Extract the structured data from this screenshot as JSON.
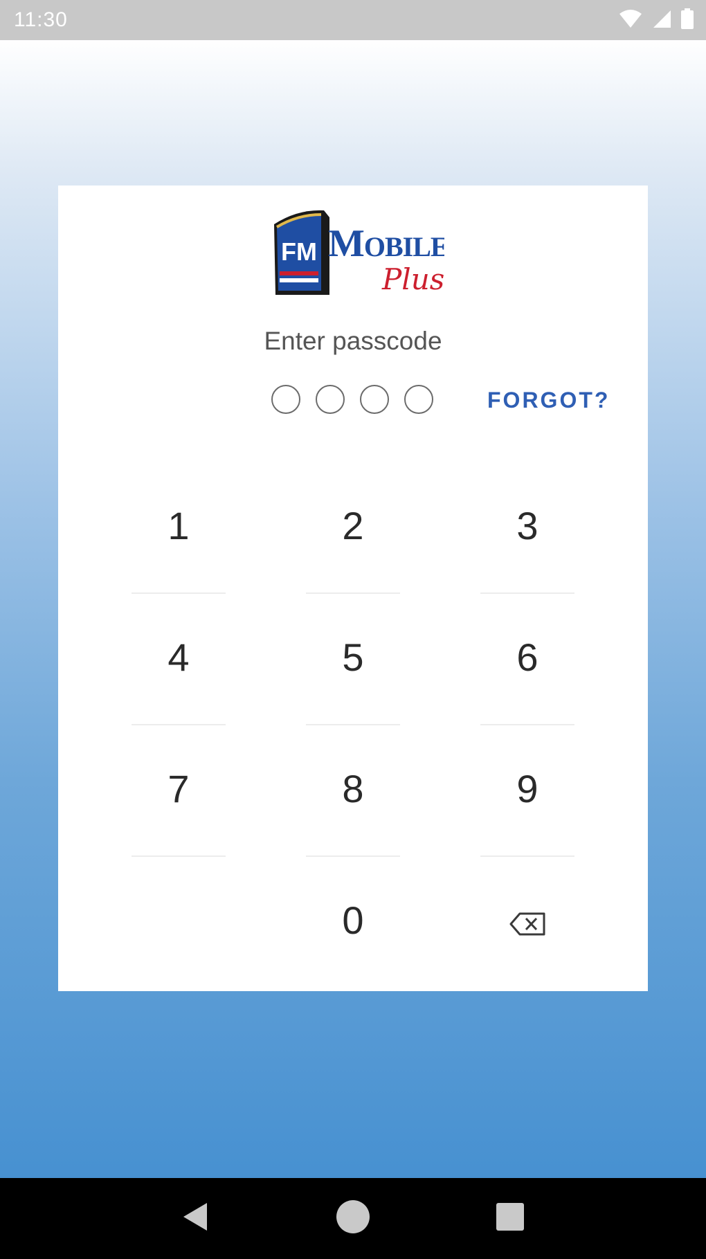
{
  "status_bar": {
    "time": "11:30",
    "icons": [
      "wifi-icon",
      "signal-icon",
      "battery-icon"
    ]
  },
  "logo": {
    "fm_text": "FM",
    "brand_text": "Mobile",
    "script_text": "Plus"
  },
  "prompt": "Enter passcode",
  "passcode": {
    "length": 4,
    "filled": 0
  },
  "forgot_label": "FORGOT?",
  "keypad": {
    "keys": [
      "1",
      "2",
      "3",
      "4",
      "5",
      "6",
      "7",
      "8",
      "9",
      "",
      "0",
      "backspace-icon"
    ]
  },
  "nav_bar": {
    "icons": [
      "back-icon",
      "home-icon",
      "recents-icon"
    ]
  },
  "colors": {
    "accent": "#2f5fb4",
    "status_bar": "#c8c8c8",
    "logo_blue": "#1f4ea3",
    "logo_red": "#cc1f2e"
  }
}
